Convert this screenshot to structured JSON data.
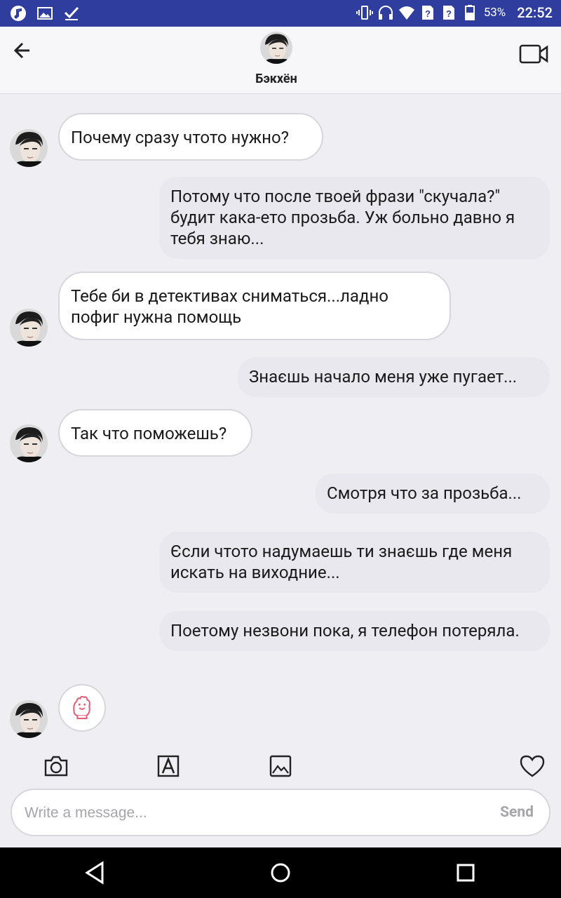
{
  "status_bar": {
    "battery_percent": "53%",
    "time": "22:52",
    "left_icons": [
      "music-icon",
      "image-icon",
      "check-icon"
    ],
    "right_icons": [
      "vibrate-icon",
      "headphones-icon",
      "wifi-icon",
      "sim-unknown-icon",
      "sim-unknown-icon",
      "battery-icon"
    ],
    "bar_color": "#2f3d9e"
  },
  "header": {
    "contact_name": "Бэкхён",
    "back_icon": "arrow-left-icon",
    "video_icon": "video-camera-icon"
  },
  "messages": [
    {
      "direction": "in",
      "text": "Почему сразу чтото нужно?"
    },
    {
      "direction": "out",
      "text": "Потому что после твоей фрази \"скучала?\" будит кака-ето прозьба. Уж больно давно я тебя знаю..."
    },
    {
      "direction": "in",
      "text": "Тебе би в детективах сниматься...ладно пофиг нужна помощь"
    },
    {
      "direction": "out",
      "text": "Знаєшь начало меня уже пугает..."
    },
    {
      "direction": "in",
      "text": "Так что поможешь?"
    },
    {
      "direction": "out",
      "text": "Смотря что за прозьба..."
    },
    {
      "direction": "out",
      "text": "Єсли чтото надумаешь ти знаєшь где меня искать на виходние..."
    },
    {
      "direction": "out",
      "text": "Поетому незвони пока, я телефон потеряла."
    },
    {
      "direction": "in",
      "type": "sticker",
      "sticker_icon": "cat-paw-icon"
    }
  ],
  "toolbar": {
    "items": [
      "camera-icon",
      "text-style-icon",
      "gallery-icon",
      "heart-icon"
    ]
  },
  "composer": {
    "placeholder": "Write a message...",
    "value": "",
    "send_label": "Send"
  },
  "navigation_bar": {
    "items": [
      "back-triangle-icon",
      "home-circle-icon",
      "recents-square-icon"
    ]
  },
  "colors": {
    "background": "#efeef3",
    "incoming_bubble": "#ffffff",
    "outgoing_bubble": "#e9e8ee",
    "sticker_accent": "#e0607a"
  }
}
